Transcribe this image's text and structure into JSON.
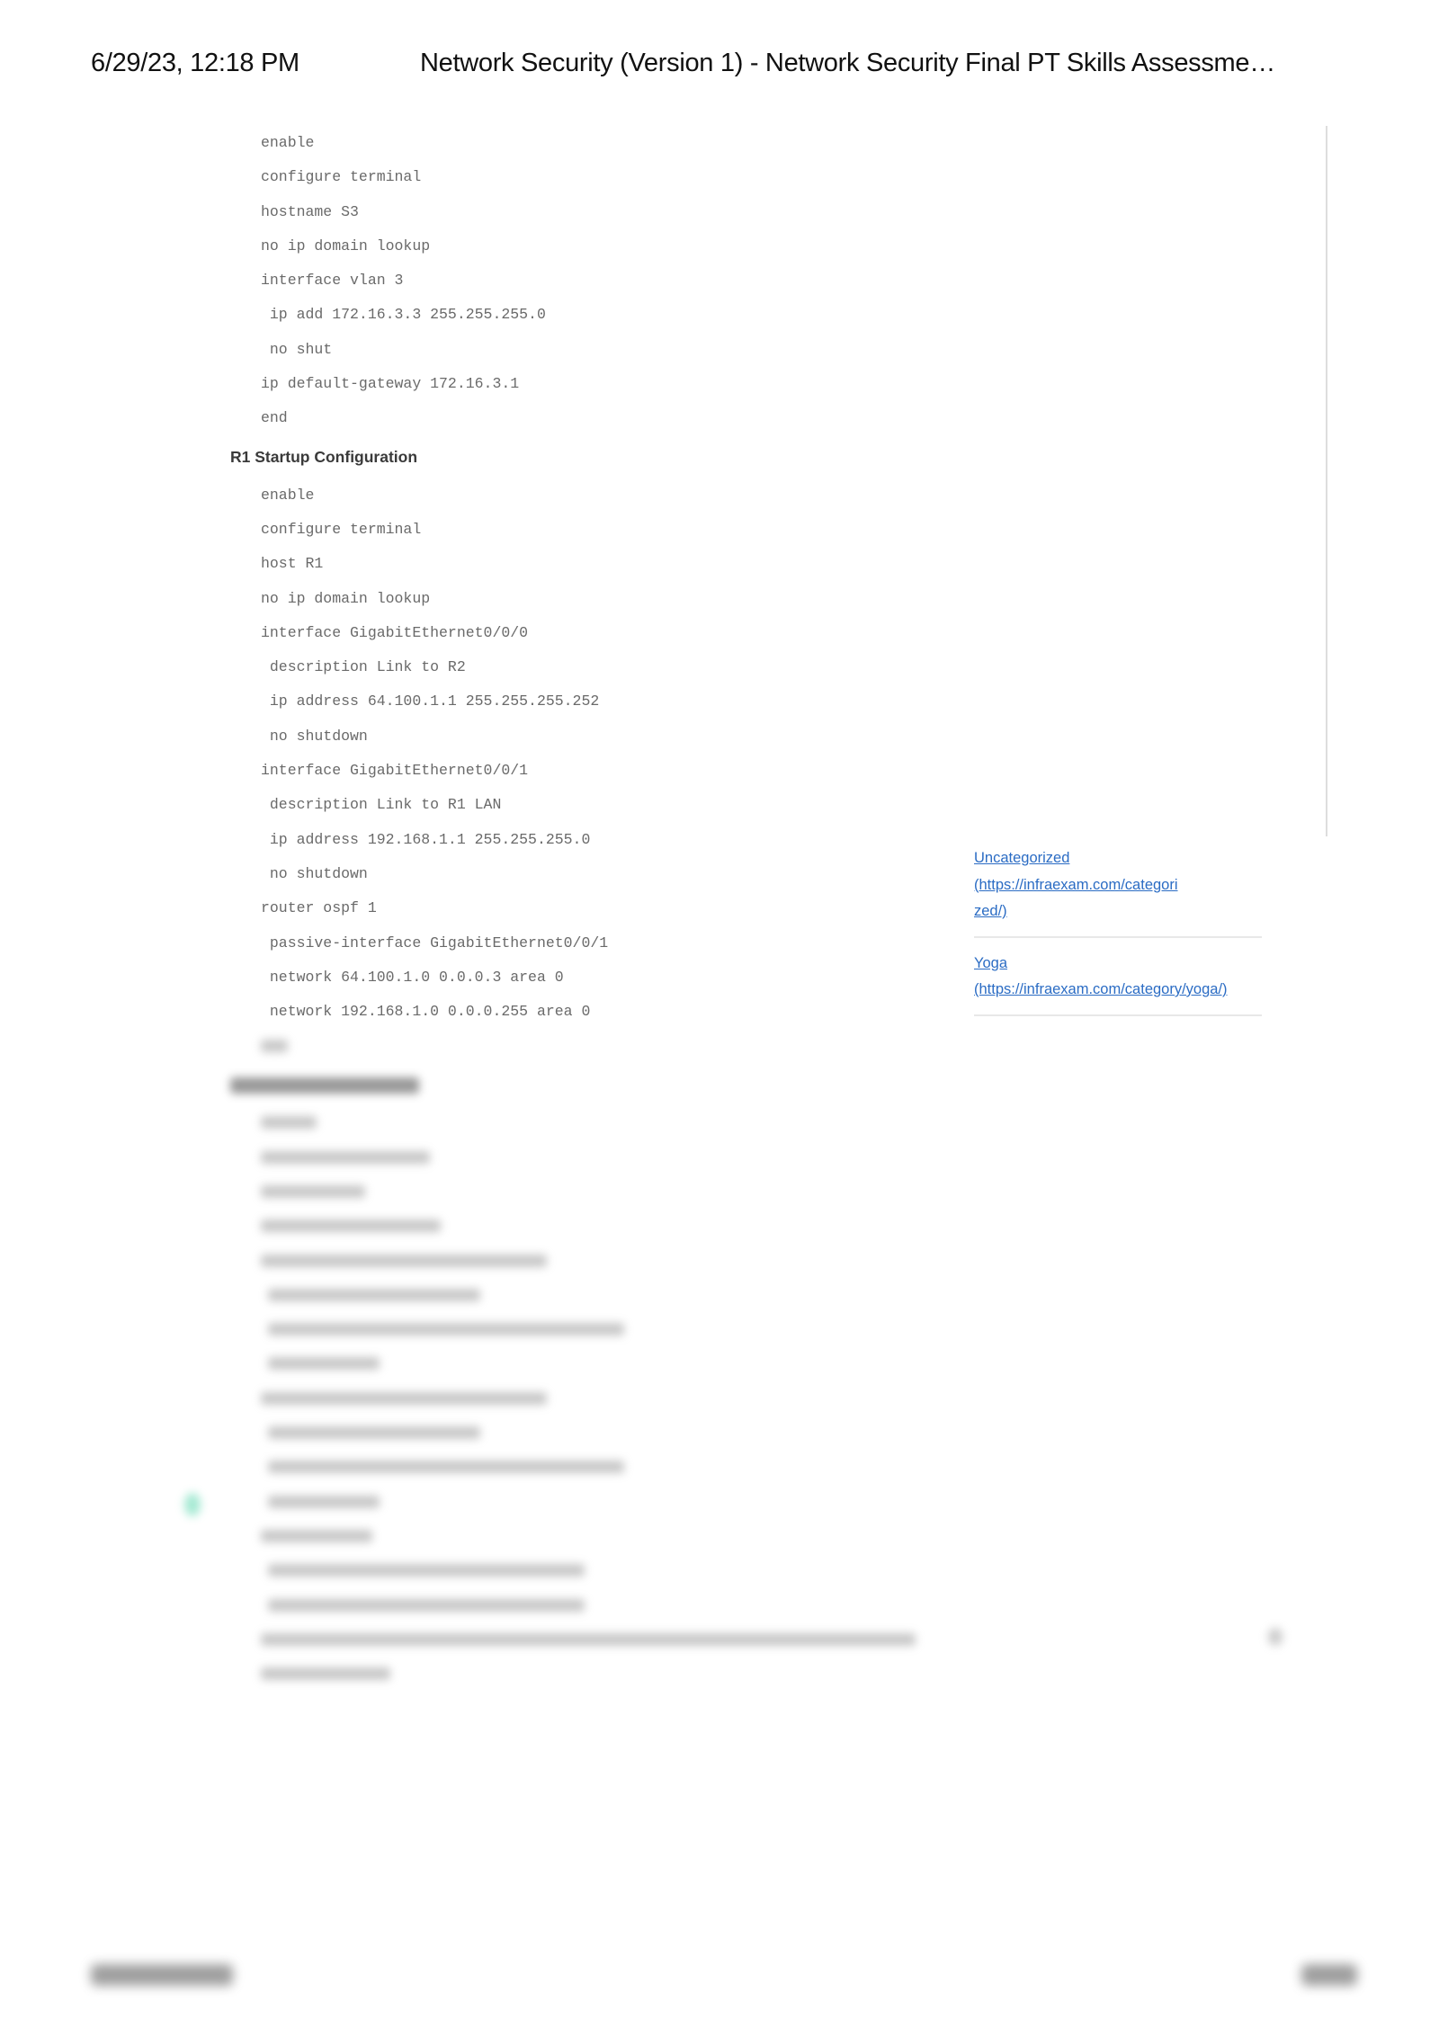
{
  "print_header": {
    "date": "6/29/23, 12:18 PM",
    "title": "Network Security (Version 1) - Network Security Final PT Skills Assessme…"
  },
  "s3_config": {
    "lines": [
      "enable",
      "configure terminal",
      "hostname S3",
      "no ip domain lookup",
      "interface vlan 3",
      " ip add 172.16.3.3 255.255.255.0",
      " no shut",
      "ip default-gateway 172.16.3.1",
      "end"
    ]
  },
  "r1_config": {
    "heading": "R1 Startup Configuration",
    "lines": [
      "enable",
      "configure terminal",
      "host R1",
      "no ip domain lookup",
      "interface GigabitEthernet0/0/0",
      " description Link to R2",
      " ip address 64.100.1.1 255.255.255.252",
      " no shutdown",
      "interface GigabitEthernet0/0/1",
      " description Link to R1 LAN",
      " ip address 192.168.1.1 255.255.255.0",
      " no shutdown",
      "router ospf 1",
      " passive-interface GigabitEthernet0/0/1",
      " network 64.100.1.0 0.0.0.3 area 0",
      " network 192.168.1.0 0.0.0.255 area 0"
    ]
  },
  "sidebar": {
    "categories": [
      {
        "label": "Uncategorized",
        "url": "(https://infraexam.com/categorized/)"
      },
      {
        "label": "Yoga",
        "url": "(https://infraexam.com/category/yoga/)"
      }
    ]
  },
  "colors": {
    "link": "#2b6cc4",
    "code_text": "#6a6a6a",
    "heading_text": "#3a3a3a"
  }
}
